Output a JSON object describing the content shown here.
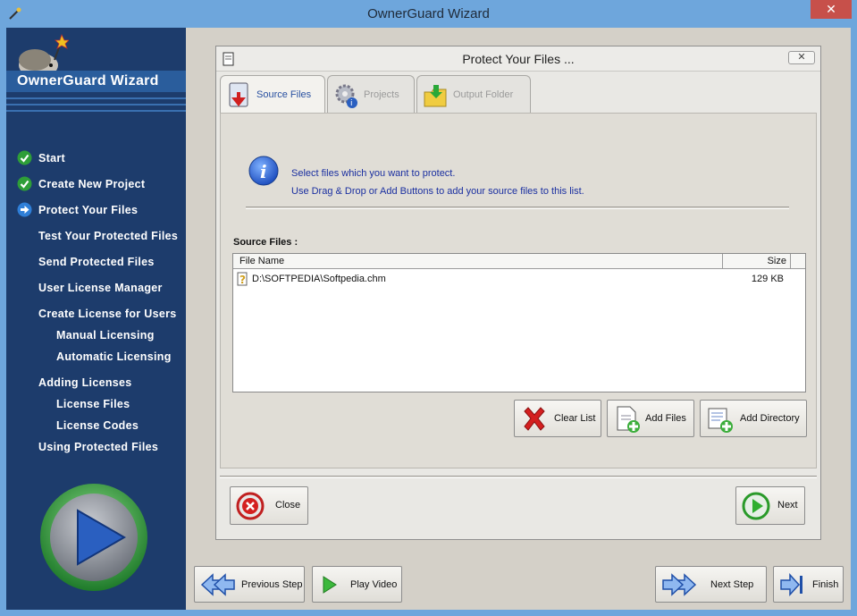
{
  "window": {
    "title": "OwnerGuard Wizard",
    "close_symbol": "✕"
  },
  "sidebar": {
    "brand": "OwnerGuard Wizard",
    "items": [
      {
        "label": "Start",
        "state": "done"
      },
      {
        "label": "Create New Project",
        "state": "done"
      },
      {
        "label": "Protect Your Files",
        "state": "current"
      },
      {
        "label": "Test Your Protected Files",
        "state": "pending"
      },
      {
        "label": "Send Protected Files",
        "state": "pending"
      },
      {
        "label": "User License Manager",
        "state": "pending"
      },
      {
        "label": "Create License for Users",
        "state": "pending"
      },
      {
        "label": "Manual Licensing",
        "state": "sub"
      },
      {
        "label": "Automatic Licensing",
        "state": "sub"
      },
      {
        "label": "Adding Licenses",
        "state": "pending"
      },
      {
        "label": "License Files",
        "state": "sub"
      },
      {
        "label": "License Codes",
        "state": "sub"
      },
      {
        "label": "Using Protected Files",
        "state": "pending"
      }
    ]
  },
  "dialog": {
    "title": "Protect Your Files ...",
    "close_symbol": "✕",
    "tabs": [
      {
        "label": "Source Files",
        "active": true,
        "icon": "source-files-icon"
      },
      {
        "label": "Projects",
        "active": false,
        "icon": "projects-gear-icon"
      },
      {
        "label": "Output Folder",
        "active": false,
        "icon": "output-folder-icon"
      }
    ],
    "info": {
      "line1": "Select files which you want to protect.",
      "line2": "Use Drag & Drop or Add Buttons to add your source files to this list."
    },
    "source_label": "Source Files :",
    "columns": {
      "name": "File Name",
      "size": "Size"
    },
    "files": [
      {
        "name": "D:\\SOFTPEDIA\\Softpedia.chm",
        "size": "129 KB"
      }
    ],
    "buttons": {
      "clear": "Clear List",
      "add_files": "Add Files",
      "add_directory": "Add Directory",
      "close": "Close",
      "next": "Next"
    }
  },
  "bottom": {
    "previous": "Previous Step",
    "play": "Play Video",
    "next_step": "Next Step",
    "finish": "Finish"
  },
  "colors": {
    "sidebar_bg": "#1d3c6c",
    "titlebar_bg": "#6ea6dc",
    "info_text": "#1a2fa0"
  }
}
